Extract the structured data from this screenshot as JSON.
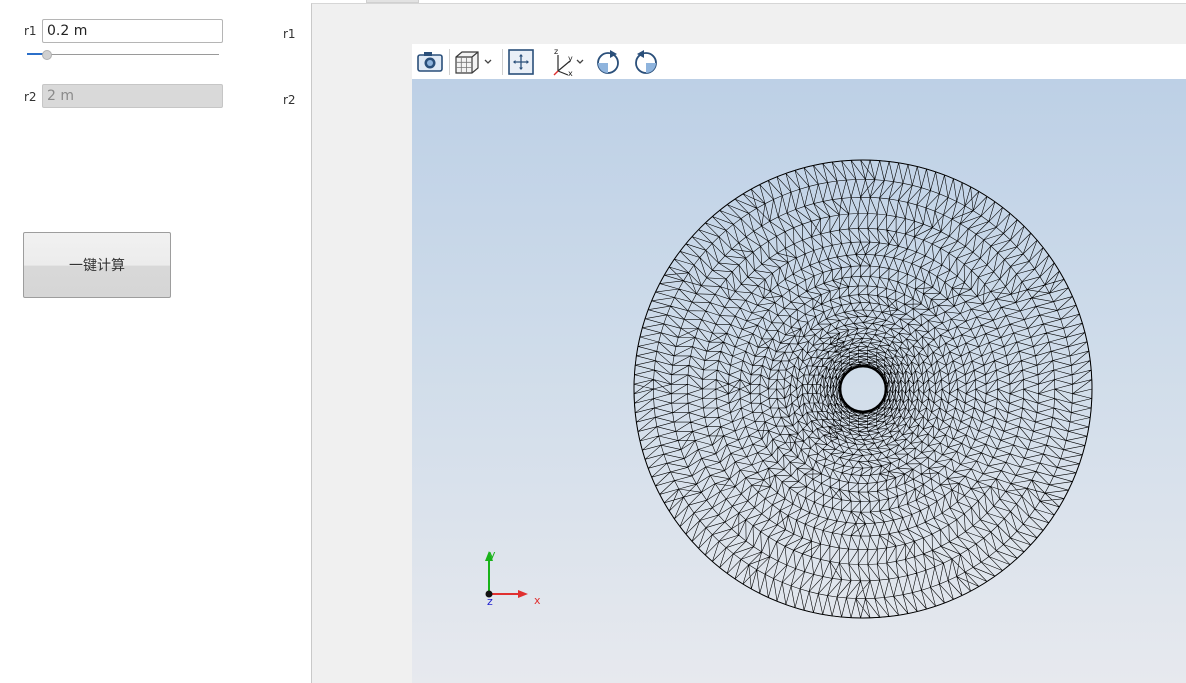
{
  "params": {
    "r1_label": "r1",
    "r1_value": "0.2 m",
    "r1_slider_level": 0.1,
    "r2_label": "r2",
    "r2_value": "2 m",
    "side_r1_label": "r1",
    "side_r2_label": "r2"
  },
  "actions": {
    "calc_label": "一键计算"
  },
  "toolbar": {
    "icons": [
      "camera-icon",
      "cube-view-icon",
      "fit-view-icon",
      "axes-orientation-icon",
      "rotate-clockwise-icon",
      "rotate-counterclockwise-icon"
    ]
  },
  "axes_triad": {
    "x_label": "x",
    "y_label": "y",
    "z_label": "z",
    "x_color": "#e03030",
    "y_color": "#19b319",
    "z_color": "#2020d0"
  },
  "mesh": {
    "outer_radius_label": "2 m",
    "inner_radius_label": "0.2 m",
    "stroke_color": "#000000"
  }
}
